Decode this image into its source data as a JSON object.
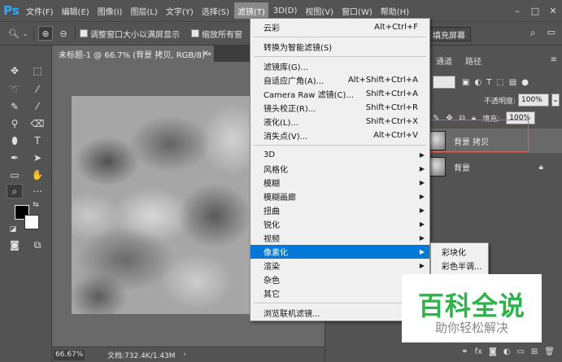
{
  "app": {
    "logo": "Ps"
  },
  "menubar": {
    "items": [
      "文件(F)",
      "编辑(E)",
      "图像(I)",
      "图层(L)",
      "文字(Y)",
      "选择(S)",
      "滤镜(T)",
      "3D(D)",
      "视图(V)",
      "窗口(W)",
      "帮助(H)"
    ],
    "active_index": 6,
    "window_buttons": [
      "minimize-icon",
      "maximize-icon",
      "close-icon"
    ]
  },
  "options": {
    "resize_windows_label": "调整窗口大小以满屏显示",
    "zoom_all_label": "缩放所有窗",
    "fill_screen_label": "填充屏幕"
  },
  "document": {
    "tab_title": "未标题-1 @ 66.7% (背景 拷贝, RGB/8) *",
    "zoom": "66.67%",
    "doc_info": "文档:732.4K/1.43M"
  },
  "panel": {
    "tabs": [
      "通道",
      "路径"
    ],
    "opacity_label": "不透明度:",
    "opacity_value": "100%",
    "fill_label": "填充:",
    "fill_value": "100%",
    "layers": [
      {
        "name": "背景 拷贝",
        "selected": true,
        "locked": false
      },
      {
        "name": "背景",
        "selected": false,
        "locked": true
      }
    ]
  },
  "filter_menu": {
    "top": [
      {
        "label": "云彩",
        "shortcut": "Alt+Ctrl+F"
      }
    ],
    "smart": [
      {
        "label": "转换为智能滤镜(S)"
      }
    ],
    "main": [
      {
        "label": "滤镜库(G)...",
        "shortcut": ""
      },
      {
        "label": "自适应广角(A)...",
        "shortcut": "Alt+Shift+Ctrl+A"
      },
      {
        "label": "Camera Raw 滤镜(C)...",
        "shortcut": "Shift+Ctrl+A"
      },
      {
        "label": "镜头校正(R)...",
        "shortcut": "Shift+Ctrl+R"
      },
      {
        "label": "液化(L)...",
        "shortcut": "Shift+Ctrl+X"
      },
      {
        "label": "消失点(V)...",
        "shortcut": "Alt+Ctrl+V"
      }
    ],
    "groups": [
      {
        "label": "3D"
      },
      {
        "label": "风格化"
      },
      {
        "label": "模糊"
      },
      {
        "label": "模糊画廊"
      },
      {
        "label": "扭曲"
      },
      {
        "label": "锐化"
      },
      {
        "label": "视频"
      },
      {
        "label": "像素化"
      },
      {
        "label": "渲染"
      },
      {
        "label": "杂色"
      },
      {
        "label": "其它"
      }
    ],
    "highlight_index": 7,
    "online": [
      {
        "label": "浏览联机滤镜..."
      }
    ]
  },
  "submenu": {
    "items": [
      "彩块化",
      "彩色半调..."
    ]
  },
  "watermark": {
    "title": "百科全说",
    "subtitle": "助你轻松解决"
  }
}
